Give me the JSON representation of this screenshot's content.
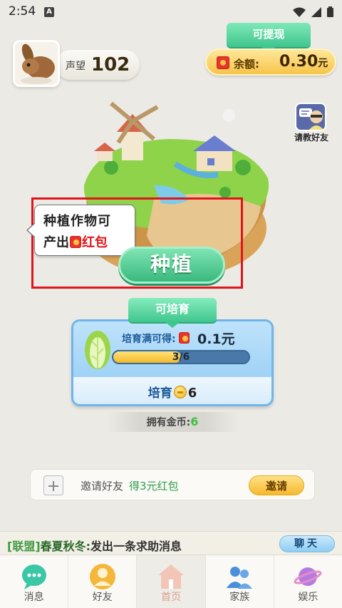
{
  "status_bar": {
    "time": "2:54",
    "notification_icon": "A"
  },
  "profile": {
    "reputation_label": "声望",
    "reputation_value": "102"
  },
  "withdraw": {
    "label": "可提现",
    "balance_label": "余额:",
    "balance_value": "0.30",
    "balance_unit": "元"
  },
  "ask_friends": {
    "label": "请教好友"
  },
  "tooltip": {
    "line1": "种植作物可",
    "line2_prefix": "产出",
    "line2_red": "红包"
  },
  "plant_button": {
    "label": "种植"
  },
  "cultivate": {
    "tab_label": "可培育",
    "reward_label": "培育满可得:",
    "reward_value": "0.1元",
    "progress_text": "3/6",
    "progress_fraction": 0.5,
    "action_label": "培育",
    "action_cost": "6"
  },
  "gold": {
    "label": "拥有金币:",
    "value": "6"
  },
  "invite": {
    "text": "邀请好友",
    "reward": "得3元红包",
    "button_label": "邀请"
  },
  "alliance": {
    "tag": "[联盟]",
    "name": "春夏秋冬:",
    "message": "发出一条求助消息",
    "chat_button": "聊天"
  },
  "nav": [
    {
      "label": "消息",
      "icon": "chat-bubble-icon"
    },
    {
      "label": "好友",
      "icon": "friend-icon"
    },
    {
      "label": "首页",
      "icon": "home-icon"
    },
    {
      "label": "家族",
      "icon": "family-icon"
    },
    {
      "label": "娱乐",
      "icon": "planet-icon"
    }
  ],
  "colors": {
    "green": "#3fc68e",
    "red": "#e0141a",
    "gold": "#f6b92c",
    "blue": "#6fb5ec"
  }
}
